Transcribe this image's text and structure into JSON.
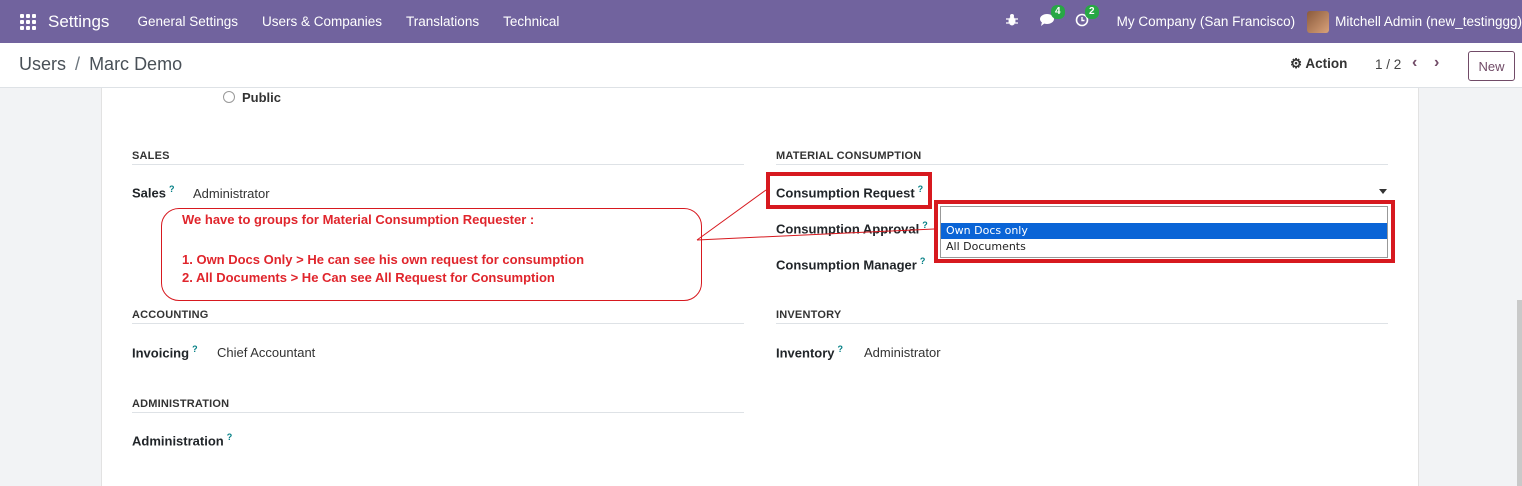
{
  "navbar": {
    "app_title": "Settings",
    "menu": [
      "General Settings",
      "Users & Companies",
      "Translations",
      "Technical"
    ],
    "messages_count": "4",
    "activities_count": "2",
    "company": "My Company (San Francisco)",
    "user": "Mitchell Admin (new_testinggg)"
  },
  "control_panel": {
    "breadcrumb_parent": "Users",
    "breadcrumb_separator": "/",
    "breadcrumb_current": "Marc Demo",
    "action_label": "Action",
    "pager": "1 / 2",
    "prev": "‹",
    "next": "›",
    "new_label": "New"
  },
  "form": {
    "public_option": "Public",
    "sales": {
      "title": "SALES",
      "field_label": "Sales",
      "field_value": "Administrator"
    },
    "material_consumption": {
      "title": "MATERIAL CONSUMPTION",
      "request_label": "Consumption Request",
      "approval_label": "Consumption Approval",
      "manager_label": "Consumption Manager",
      "dropdown_options": [
        "Own Docs only",
        "All Documents"
      ],
      "selected_option": "Own Docs only"
    },
    "accounting": {
      "title": "ACCOUNTING",
      "field_label": "Invoicing",
      "field_value": "Chief Accountant"
    },
    "inventory": {
      "title": "INVENTORY",
      "field_label": "Inventory",
      "field_value": "Administrator"
    },
    "administration": {
      "title": "ADMINISTRATION",
      "field_label": "Administration"
    },
    "help_mark": "?"
  },
  "annotation": {
    "line1": "We have to groups for Material Consumption Requester :",
    "line2": "1. Own Docs Only > He can see his own request for consumption",
    "line3": "2. All Documents >  He Can see All Request for Consumption",
    "color": "#d7191f"
  }
}
